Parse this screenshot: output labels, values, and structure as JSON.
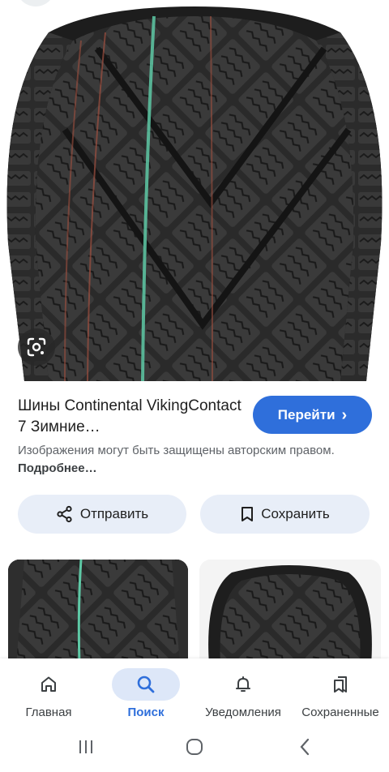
{
  "result": {
    "title": "Шины Continental VikingContact 7 Зимние…",
    "visit_label": "Перейти",
    "visit_chevron": "›",
    "copyright_text": "Изображения могут быть защищены авторским правом.",
    "copyright_more": "Подробнее…",
    "share_label": "Отправить",
    "save_label": "Сохранить"
  },
  "icons": {
    "lens": "google-lens-icon",
    "visit": "chevron-right-icon",
    "share": "share-icon",
    "save": "bookmark-icon",
    "home": "home-icon",
    "search": "search-icon",
    "notifications": "bell-icon",
    "saved": "saved-collections-icon"
  },
  "bottom_nav": {
    "items": [
      {
        "label": "Главная",
        "icon": "home-icon",
        "active": false
      },
      {
        "label": "Поиск",
        "icon": "search-icon",
        "active": true
      },
      {
        "label": "Уведомления",
        "icon": "bell-icon",
        "active": false
      },
      {
        "label": "Сохраненные",
        "icon": "saved-collections-icon",
        "active": false
      }
    ]
  },
  "colors": {
    "accent": "#2f6fdb",
    "button_bg": "#e8eef8",
    "active_pill": "#dde7f8",
    "text_primary": "#1f1f1f",
    "text_secondary": "#5f6368",
    "tread": "#1c1c1c"
  }
}
